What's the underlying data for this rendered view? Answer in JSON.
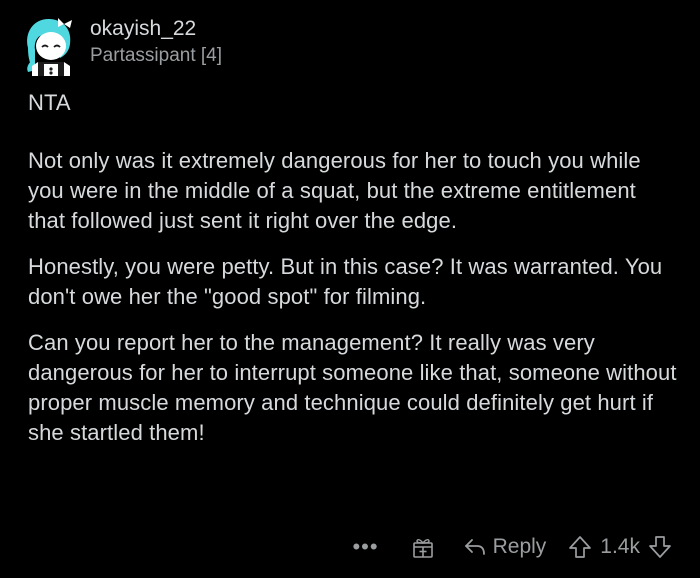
{
  "comment": {
    "username": "okayish_22",
    "flair": "Partassipant [4]",
    "paragraphs": [
      "NTA",
      "Not only was it extremely dangerous for her to touch you while you were in the middle of a squat, but the extreme entitlement that followed just sent it right over the edge.",
      "Honestly, you were petty. But in this case? It was warranted. You don't owe her the \"good spot\" for filming.",
      "Can you report her to the management? It really was very dangerous for her to interrupt someone like that, someone without proper muscle memory and technique could definitely get hurt if she startled them!"
    ]
  },
  "actions": {
    "more_label": "•••",
    "reply_label": "Reply",
    "score": "1.4k"
  },
  "icons": {
    "avatar": "avatar-icon",
    "award": "gift-icon",
    "reply": "reply-arrow-icon",
    "upvote": "upvote-arrow-icon",
    "downvote": "downvote-arrow-icon"
  },
  "colors": {
    "background": "#000000",
    "text": "#d7dadc",
    "muted": "#9b9ea0",
    "avatar_hair": "#4fd8e0"
  }
}
